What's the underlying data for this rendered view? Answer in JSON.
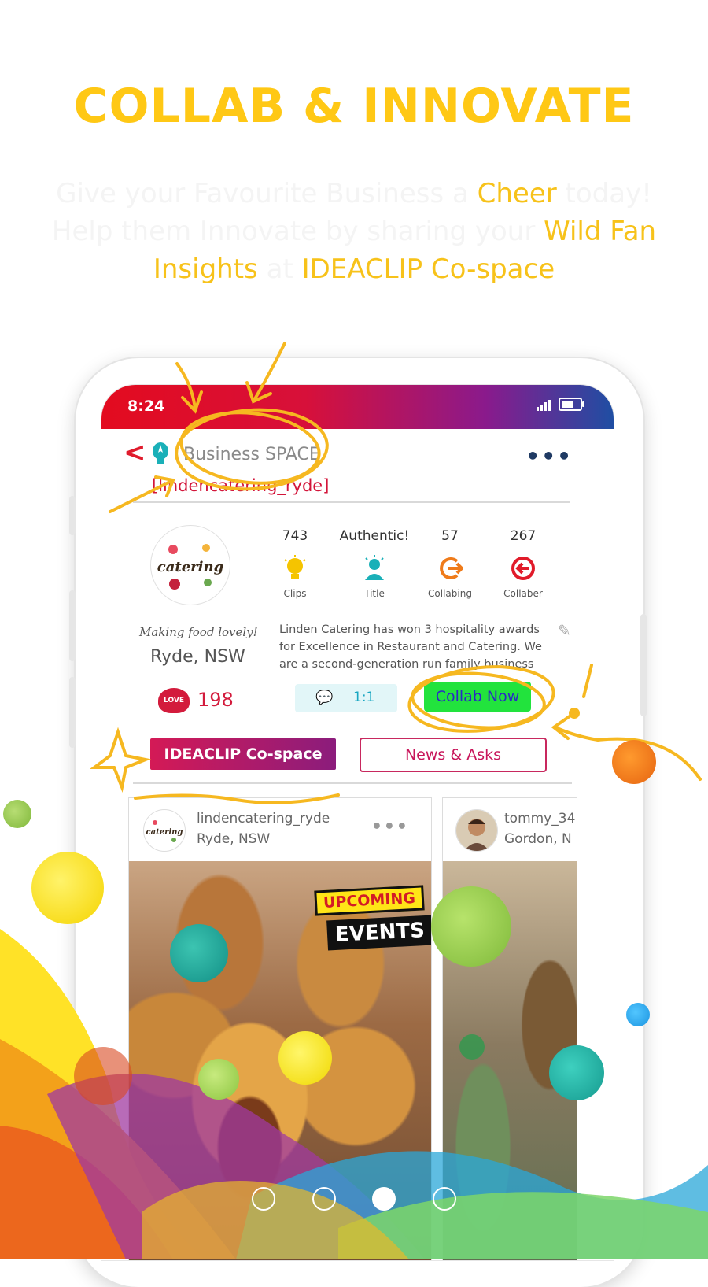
{
  "headline": "COLLAB & INNOVATE",
  "tagline": {
    "part1": "Give your Favourite Business a ",
    "cheer": "Cheer",
    "part2": " today! Help them Innovate by sharing your ",
    "insights": "Wild Fan Insights",
    "part3": " at ",
    "cospace": "IDEACLIP Co-space"
  },
  "status_bar": {
    "time": "8:24"
  },
  "header": {
    "back_icon": "chevron-left-icon",
    "title": "Business SPACE",
    "handle": "[lindencatering_ryde]",
    "more_icon": "more-icon"
  },
  "profile": {
    "stats": [
      {
        "value": "743",
        "label": "Clips",
        "icon": "bulb-icon",
        "color": "#f5c400"
      },
      {
        "value": "Authentic!",
        "label": "Title",
        "icon": "person-idea-icon",
        "color": "#1ab0b8"
      },
      {
        "value": "57",
        "label": "Collabing",
        "icon": "collab-out-icon",
        "color": "#ef7b1a"
      },
      {
        "value": "267",
        "label": "Collaber",
        "icon": "collab-in-icon",
        "color": "#e11b2a"
      }
    ],
    "tagline": "Making food lovely!",
    "location": "Ryde, NSW",
    "bio": "Linden Catering has won 3 hospitality awards for Excellence in Restaurant and Catering. We are a second-generation run family business which",
    "love_badge": "LOVE IT!",
    "love_count": "198",
    "chat_label": "1:1",
    "collab_label": "Collab Now"
  },
  "tabs": {
    "active": "IDEACLIP Co-space",
    "other": "News & Asks"
  },
  "cards": [
    {
      "user": "lindencatering_ryde",
      "location": "Ryde, NSW",
      "badge_top": "UPCOMING",
      "badge_bottom": "EVENTS"
    },
    {
      "user": "tommy_34",
      "location": "Gordon, N"
    }
  ],
  "logo_text": "catering",
  "colors": {
    "accent_yellow": "#ffc815",
    "brand_red": "#e30b1f",
    "collab_green": "#22e33d"
  },
  "pagination": {
    "count": 4,
    "active_index": 2
  }
}
